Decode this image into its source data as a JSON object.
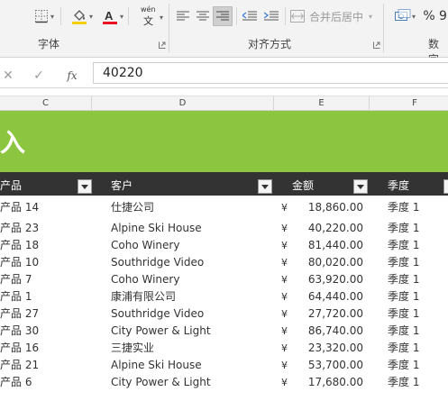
{
  "ribbon": {
    "groups": [
      {
        "label": "字体"
      },
      {
        "label": "对齐方式"
      },
      {
        "label": "数字"
      }
    ],
    "merge_center_label": "合并后居中",
    "font_color_accent": "#e81123",
    "fill_color_accent": "#f5d000",
    "phonetic_top": "wén",
    "phonetic_bottom": "文",
    "percent_label": "%"
  },
  "formula_bar": {
    "cancel_symbol": "✕",
    "confirm_symbol": "✓",
    "fx_label": "fx",
    "value": "40220"
  },
  "columns": [
    {
      "letter": "C"
    },
    {
      "letter": "D"
    },
    {
      "letter": "E"
    },
    {
      "letter": "F"
    }
  ],
  "sheet": {
    "banner_color": "#8cc540",
    "banner_title": "入",
    "header_bg": "#333333",
    "headers": [
      {
        "label": "产品"
      },
      {
        "label": "客户"
      },
      {
        "label": "金额"
      },
      {
        "label": "季度"
      }
    ],
    "rows": [
      {
        "product": "产品 14",
        "customer": "仕捷公司",
        "currency": "¥",
        "amount": "18,860.00",
        "quarter": "季度 1"
      },
      {
        "product": "产品 23",
        "customer": "Alpine Ski House",
        "currency": "¥",
        "amount": "40,220.00",
        "quarter": "季度 1"
      },
      {
        "product": "产品 18",
        "customer": "Coho Winery",
        "currency": "¥",
        "amount": "81,440.00",
        "quarter": "季度 1"
      },
      {
        "product": "产品 10",
        "customer": "Southridge Video",
        "currency": "¥",
        "amount": "80,020.00",
        "quarter": "季度 1"
      },
      {
        "product": "产品 7",
        "customer": "Coho Winery",
        "currency": "¥",
        "amount": "63,920.00",
        "quarter": "季度 1"
      },
      {
        "product": "产品 1",
        "customer": "康浦有限公司",
        "currency": "¥",
        "amount": "64,440.00",
        "quarter": "季度 1"
      },
      {
        "product": "产品 27",
        "customer": "Southridge Video",
        "currency": "¥",
        "amount": "27,720.00",
        "quarter": "季度 1"
      },
      {
        "product": "产品 30",
        "customer": "City Power & Light",
        "currency": "¥",
        "amount": "86,740.00",
        "quarter": "季度 1"
      },
      {
        "product": "产品 16",
        "customer": "三捷实业",
        "currency": "¥",
        "amount": "23,320.00",
        "quarter": "季度 1"
      },
      {
        "product": "产品 21",
        "customer": "Alpine Ski House",
        "currency": "¥",
        "amount": "53,700.00",
        "quarter": "季度 1"
      },
      {
        "product": "产品 6",
        "customer": "City Power & Light",
        "currency": "¥",
        "amount": "17,680.00",
        "quarter": "季度 1"
      }
    ]
  }
}
